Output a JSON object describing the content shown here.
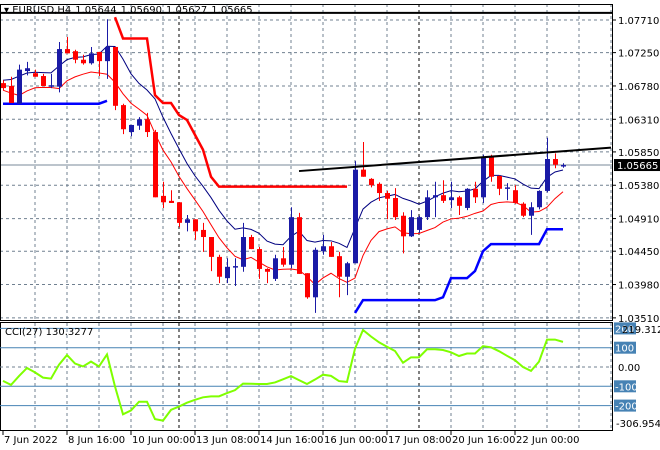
{
  "header": {
    "symbol": "▾ EURUSD,H4",
    "open": "1.05644",
    "high": "1.05690",
    "low": "1.05627",
    "close": "1.05665"
  },
  "colors": {
    "bull": "#1a1aa6",
    "bear": "#ff0000",
    "ma_upper": "#000080",
    "ma_lower": "#ff0000",
    "stop_upper": "#ff0000",
    "stop_lower": "#0000ff",
    "trendline": "#000000",
    "cci": "#7fff00",
    "cci_levels": "#4682b4",
    "grid": "#708090"
  },
  "price_axis": {
    "labels": [
      "1.07710",
      "1.07250",
      "1.06780",
      "1.06310",
      "1.05850",
      "1.05380",
      "1.04910",
      "1.04450",
      "1.03980",
      "1.03510"
    ],
    "current_price": "1.05665",
    "range": [
      1.0351,
      1.0771
    ]
  },
  "time_axis": {
    "labels": [
      "7 Jun 2022",
      "8 Jun 16:00",
      "10 Jun 00:00",
      "13 Jun 08:00",
      "14 Jun 16:00",
      "16 Jun 00:00",
      "17 Jun 08:00",
      "20 Jun 16:00",
      "22 Jun 00:00"
    ],
    "label_candle_index": [
      0,
      8,
      16,
      24,
      32,
      40,
      48,
      56,
      64
    ],
    "day_separators_candle_index": [
      22,
      52
    ]
  },
  "candles_ohlc": [
    [
      1.0682,
      1.0686,
      1.0672,
      1.0675
    ],
    [
      1.0678,
      1.0691,
      1.0654,
      1.0654
    ],
    [
      1.0653,
      1.0708,
      1.0653,
      1.0701
    ],
    [
      1.0699,
      1.0712,
      1.0693,
      1.0703
    ],
    [
      1.0696,
      1.0701,
      1.0691,
      1.0691
    ],
    [
      1.0692,
      1.0695,
      1.0678,
      1.0678
    ],
    [
      1.0678,
      1.0695,
      1.0675,
      1.0679
    ],
    [
      1.0677,
      1.074,
      1.0669,
      1.073
    ],
    [
      1.073,
      1.0747,
      1.0724,
      1.0724
    ],
    [
      1.0727,
      1.0729,
      1.071,
      1.0715
    ],
    [
      1.0715,
      1.0722,
      1.0708,
      1.071
    ],
    [
      1.071,
      1.0733,
      1.0708,
      1.0724
    ],
    [
      1.0726,
      1.0726,
      1.0692,
      1.0713
    ],
    [
      1.0713,
      1.0772,
      1.0688,
      1.0733
    ],
    [
      1.0733,
      1.0733,
      1.0644,
      1.065
    ],
    [
      1.0651,
      1.0653,
      1.061,
      1.0617
    ],
    [
      1.0613,
      1.0623,
      1.0607,
      1.0623
    ],
    [
      1.0622,
      1.0634,
      1.0616,
      1.0631
    ],
    [
      1.0631,
      1.064,
      1.0606,
      1.0613
    ],
    [
      1.0613,
      1.0616,
      1.0521,
      1.0521
    ],
    [
      1.0523,
      1.0543,
      1.0506,
      1.0514
    ],
    [
      1.0516,
      1.0531,
      1.0513,
      1.0513
    ],
    [
      1.0514,
      1.0514,
      1.0479,
      1.0485
    ],
    [
      1.0485,
      1.0496,
      1.0473,
      1.049
    ],
    [
      1.049,
      1.049,
      1.0461,
      1.0473
    ],
    [
      1.0475,
      1.0485,
      1.0444,
      1.0465
    ],
    [
      1.0465,
      1.0465,
      1.0417,
      1.0437
    ],
    [
      1.0437,
      1.044,
      1.04,
      1.0409
    ],
    [
      1.0407,
      1.0435,
      1.04,
      1.0423
    ],
    [
      1.0423,
      1.0435,
      1.0396,
      1.0424
    ],
    [
      1.0423,
      1.0485,
      1.0416,
      1.0465
    ],
    [
      1.0465,
      1.0468,
      1.0448,
      1.0448
    ],
    [
      1.0448,
      1.0451,
      1.0406,
      1.042
    ],
    [
      1.042,
      1.0421,
      1.04,
      1.0416
    ],
    [
      1.0406,
      1.044,
      1.0403,
      1.0435
    ],
    [
      1.0435,
      1.0451,
      1.0423,
      1.0426
    ],
    [
      1.0426,
      1.0507,
      1.0421,
      1.0493
    ],
    [
      1.0493,
      1.0499,
      1.0413,
      1.0413
    ],
    [
      1.0414,
      1.0414,
      1.0378,
      1.038
    ],
    [
      1.038,
      1.045,
      1.0358,
      1.0447
    ],
    [
      1.0445,
      1.0468,
      1.044,
      1.0452
    ],
    [
      1.0452,
      1.0458,
      1.0437,
      1.0437
    ],
    [
      1.0438,
      1.0444,
      1.038,
      1.0409
    ],
    [
      1.0409,
      1.043,
      1.0383,
      1.0428
    ],
    [
      1.0428,
      1.0572,
      1.0428,
      1.056
    ],
    [
      1.056,
      1.0599,
      1.055,
      1.055
    ],
    [
      1.0547,
      1.0548,
      1.0535,
      1.0538
    ],
    [
      1.054,
      1.0542,
      1.0516,
      1.0527
    ],
    [
      1.0527,
      1.053,
      1.049,
      1.0519
    ],
    [
      1.052,
      1.0534,
      1.0489,
      1.0493
    ],
    [
      1.0495,
      1.05,
      1.0442,
      1.0466
    ],
    [
      1.0466,
      1.0503,
      1.0465,
      1.0493
    ],
    [
      1.0475,
      1.0495,
      1.0471,
      1.0493
    ],
    [
      1.0493,
      1.0531,
      1.0489,
      1.0521
    ],
    [
      1.0521,
      1.0543,
      1.0493,
      1.0524
    ],
    [
      1.0524,
      1.0545,
      1.0513,
      1.0516
    ],
    [
      1.0517,
      1.0543,
      1.0506,
      1.0521
    ],
    [
      1.0521,
      1.0523,
      1.0496,
      1.0509
    ],
    [
      1.0506,
      1.0534,
      1.0503,
      1.0533
    ],
    [
      1.0533,
      1.0543,
      1.0513,
      1.0521
    ],
    [
      1.0521,
      1.0581,
      1.0513,
      1.0578
    ],
    [
      1.0578,
      1.0581,
      1.0543,
      1.055
    ],
    [
      1.0551,
      1.0552,
      1.0524,
      1.0533
    ],
    [
      1.0534,
      1.0541,
      1.0517,
      1.0535
    ],
    [
      1.0531,
      1.0538,
      1.0512,
      1.0513
    ],
    [
      1.0512,
      1.0514,
      1.0493,
      1.0495
    ],
    [
      1.0495,
      1.0514,
      1.0468,
      1.0507
    ],
    [
      1.0507,
      1.0531,
      1.0504,
      1.053
    ],
    [
      1.053,
      1.0605,
      1.0528,
      1.0575
    ],
    [
      1.0575,
      1.0583,
      1.0562,
      1.0567
    ],
    [
      1.05644,
      1.0569,
      1.05627,
      1.05665
    ]
  ],
  "stop_upper": [
    [
      14,
      1.0775
    ],
    [
      15,
      1.0745
    ],
    [
      18,
      1.0745
    ],
    [
      19,
      1.0665
    ],
    [
      20,
      1.0654
    ],
    [
      21,
      1.0654
    ],
    [
      22,
      1.0637
    ],
    [
      23,
      1.063
    ],
    [
      24,
      1.0609
    ],
    [
      25,
      1.0588
    ],
    [
      26,
      1.055
    ],
    [
      27,
      1.0536
    ],
    [
      43,
      1.0536
    ]
  ],
  "stop_lower_1": [
    [
      0,
      1.0653
    ],
    [
      12,
      1.0653
    ],
    [
      13,
      1.0657
    ]
  ],
  "stop_lower_2": [
    [
      44,
      1.0358
    ],
    [
      45,
      1.0376
    ],
    [
      54,
      1.0376
    ],
    [
      55,
      1.038
    ],
    [
      56,
      1.0407
    ],
    [
      58,
      1.0407
    ],
    [
      59,
      1.0417
    ],
    [
      60,
      1.0445
    ],
    [
      61,
      1.0455
    ],
    [
      67,
      1.0455
    ],
    [
      68,
      1.0476
    ],
    [
      70,
      1.0476
    ]
  ],
  "trendline": [
    [
      37,
      1.0558
    ],
    [
      76,
      1.0591
    ]
  ],
  "top_hline_price": 1.0781,
  "cci": {
    "label": "CCI(27) 130.3277",
    "max_label": "219.3126",
    "min_label": "-306.9543",
    "zero_label": "0.00",
    "range": [
      -306.9543,
      219.3126
    ],
    "levels": [
      {
        "value": 200,
        "label": "200"
      },
      {
        "value": 100,
        "label": "100"
      },
      {
        "value": -100,
        "label": "-100"
      },
      {
        "value": -200,
        "label": "-200"
      }
    ],
    "values": [
      -72,
      -93,
      -47,
      -5,
      -28,
      -55,
      -60,
      12,
      62,
      18,
      3,
      28,
      3,
      65,
      -101,
      -245,
      -225,
      -180,
      -180,
      -270,
      -278,
      -222,
      -205,
      -185,
      -170,
      -157,
      -152,
      -152,
      -135,
      -120,
      -86,
      -87,
      -88,
      -88,
      -80,
      -64,
      -47,
      -68,
      -88,
      -65,
      -40,
      -46,
      -73,
      -77,
      95,
      192,
      158,
      128,
      105,
      83,
      22,
      50,
      50,
      92,
      92,
      88,
      76,
      57,
      70,
      70,
      108,
      102,
      82,
      58,
      35,
      0,
      -20,
      28,
      142,
      142,
      130.3
    ]
  }
}
